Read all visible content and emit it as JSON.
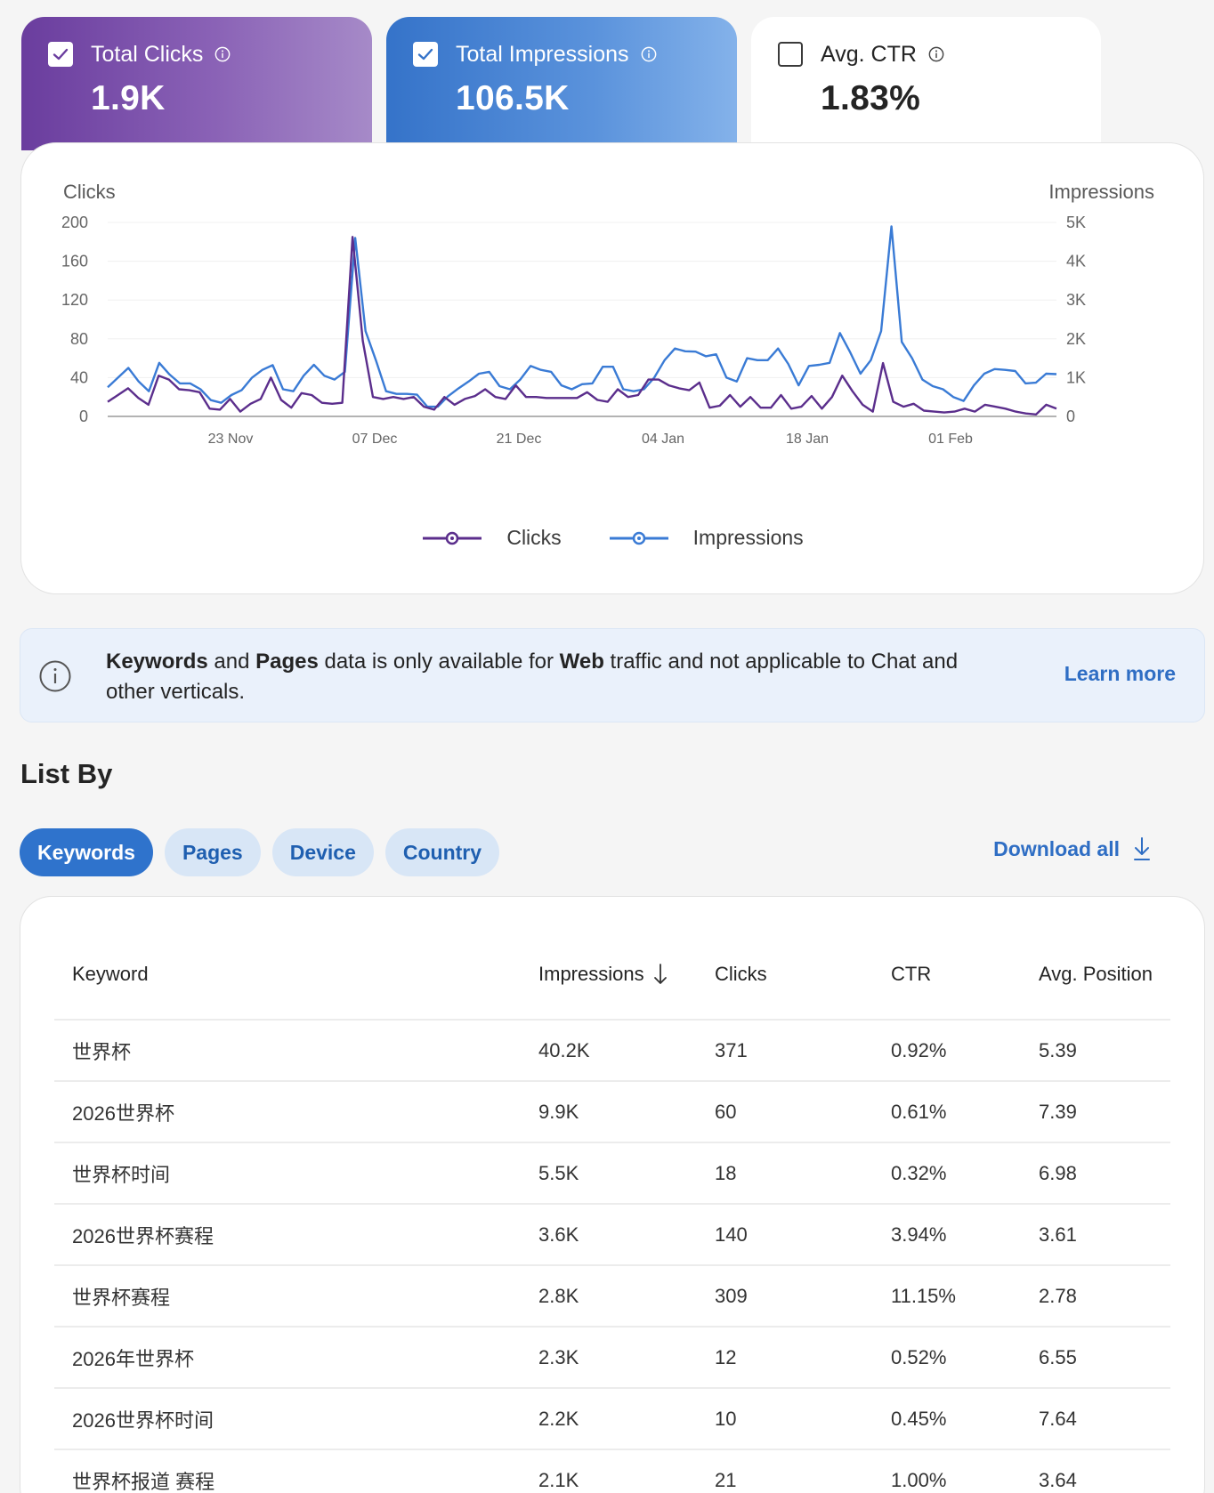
{
  "metrics": {
    "clicks": {
      "label": "Total Clicks",
      "value": "1.9K",
      "checked": true
    },
    "impressions": {
      "label": "Total Impressions",
      "value": "106.5K",
      "checked": true
    },
    "ctr": {
      "label": "Avg. CTR",
      "value": "1.83%",
      "checked": false
    }
  },
  "colors": {
    "clicks": "#5b2e8c",
    "impressions": "#3a7bd5",
    "accent": "#2f73cc"
  },
  "chart_data": {
    "type": "line",
    "left_axis_title": "Clicks",
    "right_axis_title": "Impressions",
    "left_ticks": [
      "200",
      "160",
      "120",
      "80",
      "40",
      "0"
    ],
    "right_ticks": [
      "5K",
      "4K",
      "3K",
      "2K",
      "1K",
      "0"
    ],
    "ylim_left": [
      0,
      200
    ],
    "ylim_right": [
      0,
      5000
    ],
    "x_ticks": [
      "23 Nov",
      "07 Dec",
      "21 Dec",
      "04 Jan",
      "18 Jan",
      "01 Feb"
    ],
    "grid": true,
    "legend_position": "bottom-center",
    "series": [
      {
        "name": "Clicks",
        "axis": "left",
        "values": [
          15,
          22,
          29,
          19,
          12,
          42,
          38,
          28,
          27,
          25,
          8,
          7,
          18,
          5,
          13,
          18,
          40,
          17,
          9,
          24,
          22,
          14,
          13,
          14,
          185,
          78,
          20,
          18,
          20,
          18,
          20,
          10,
          7,
          20,
          12,
          18,
          21,
          28,
          20,
          18,
          32,
          20,
          20,
          19,
          19,
          19,
          19,
          25,
          17,
          15,
          28,
          20,
          22,
          38,
          38,
          32,
          29,
          27,
          35,
          9,
          11,
          22,
          10,
          20,
          9,
          9,
          22,
          8,
          10,
          21,
          8,
          20,
          42,
          26,
          12,
          5,
          55,
          15,
          10,
          13,
          6,
          5,
          4,
          5,
          8,
          5,
          12,
          10,
          8,
          5,
          3,
          2,
          12,
          8
        ]
      },
      {
        "name": "Impressions",
        "axis": "right",
        "values": [
          750,
          1000,
          1250,
          900,
          650,
          1380,
          1080,
          850,
          850,
          700,
          420,
          350,
          550,
          680,
          1000,
          1200,
          1320,
          700,
          650,
          1050,
          1330,
          1050,
          950,
          1150,
          4600,
          2200,
          1450,
          650,
          580,
          580,
          560,
          250,
          250,
          520,
          720,
          900,
          1100,
          1150,
          780,
          700,
          950,
          1300,
          1200,
          1150,
          800,
          700,
          830,
          850,
          1280,
          1280,
          700,
          650,
          700,
          1000,
          1450,
          1750,
          1680,
          1670,
          1550,
          1600,
          1000,
          900,
          1500,
          1450,
          1450,
          1750,
          1350,
          800,
          1300,
          1330,
          1380,
          2150,
          1650,
          1100,
          1450,
          2200,
          4900,
          1920,
          1500,
          950,
          780,
          700,
          500,
          400,
          800,
          1100,
          1220,
          1200,
          1170,
          850,
          870,
          1100,
          1090
        ]
      }
    ]
  },
  "banner": {
    "kw_bold": "Keywords",
    "and": " and ",
    "pages_bold": "Pages",
    "mid": " data is only available for ",
    "web_bold": "Web",
    "tail": " traffic and not applicable to Chat and other verticals.",
    "learn_more": "Learn more"
  },
  "list_by": {
    "title": "List By",
    "tabs": [
      "Keywords",
      "Pages",
      "Device",
      "Country"
    ],
    "download": "Download all"
  },
  "table": {
    "headers": [
      "Keyword",
      "Impressions",
      "Clicks",
      "CTR",
      "Avg. Position"
    ],
    "rows": [
      [
        "世界杯",
        "40.2K",
        "371",
        "0.92%",
        "5.39"
      ],
      [
        "2026世界杯",
        "9.9K",
        "60",
        "0.61%",
        "7.39"
      ],
      [
        "世界杯时间",
        "5.5K",
        "18",
        "0.32%",
        "6.98"
      ],
      [
        "2026世界杯赛程",
        "3.6K",
        "140",
        "3.94%",
        "3.61"
      ],
      [
        "世界杯赛程",
        "2.8K",
        "309",
        "11.15%",
        "2.78"
      ],
      [
        "2026年世界杯",
        "2.3K",
        "12",
        "0.52%",
        "6.55"
      ],
      [
        "2026世界杯时间",
        "2.2K",
        "10",
        "0.45%",
        "7.64"
      ],
      [
        "世界杯报道 赛程",
        "2.1K",
        "21",
        "1.00%",
        "3.64"
      ]
    ]
  }
}
